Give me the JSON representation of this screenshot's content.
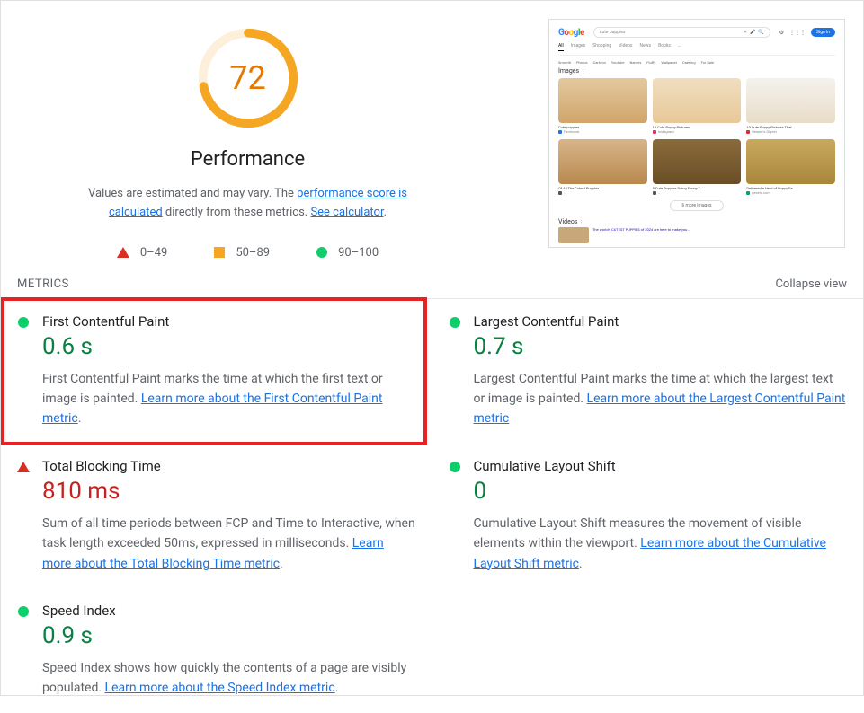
{
  "score": {
    "value": "72",
    "arc_percent": 72,
    "color": "#f5a623",
    "title": "Performance",
    "desc_prefix": "Values are estimated and may vary. The ",
    "link1": "performance score is calculated",
    "desc_mid": " directly from these metrics. ",
    "link2": "See calculator",
    "desc_suffix": "."
  },
  "legend": {
    "fail": "0–49",
    "avg": "50–89",
    "pass": "90–100"
  },
  "preview": {
    "logo": "Google",
    "query": "cute puppies",
    "signin": "Sign in",
    "tabs": [
      "All",
      "Images",
      "Shopping",
      "Videos",
      "News",
      "Books",
      "…"
    ],
    "chips": [
      "Smooth",
      "Photos",
      "Cartoon",
      "Youtube",
      "Names",
      "Fluffy",
      "Wallpaper",
      "Drawing",
      "For Sale"
    ],
    "images_heading": "Images",
    "six_images_btn": "6 more images",
    "cards": [
      {
        "cap": "Cute puppies",
        "src": "Facebook",
        "fav": "#1877F2",
        "bg": "linear-gradient(#e3c9a0,#d1a56a)"
      },
      {
        "cap": "10 Cute Puppy Pictures",
        "src": "Instagram",
        "fav": "#E1306C",
        "bg": "linear-gradient(#f0dec0,#e8c898)"
      },
      {
        "cap": "10 Cute Puppy Pictures That …",
        "src": "Reader's Digest",
        "fav": "#d93025",
        "bg": "linear-gradient(#f5f2ed,#e8dcc8)"
      },
      {
        "cap": "Of All The Cutest Puppies …",
        "src": "…",
        "fav": "#555",
        "bg": "linear-gradient(#d8b58a,#b8894f)"
      },
      {
        "cap": "8 Cute Puppies Doing Funny T…",
        "src": "…",
        "fav": "#555",
        "bg": "linear-gradient(#8a6b3a,#6a4e28)"
      },
      {
        "cap": "Delivered a Herd of Puppy Fa…",
        "src": "pexels.com",
        "fav": "#05A081",
        "bg": "linear-gradient(#c9a95e,#a8873c)"
      }
    ],
    "videos_heading": "Videos",
    "video_line": "The world's CUTEST PUPPIES of 2024 are here to make you …"
  },
  "metrics_header": {
    "title": "METRICS",
    "collapse": "Collapse view"
  },
  "metrics": {
    "fcp": {
      "name": "First Contentful Paint",
      "value": "0.6 s",
      "status": "green",
      "desc": "First Contentful Paint marks the time at which the first text or image is painted. ",
      "link": "Learn more about the First Contentful Paint metric",
      "suffix": "."
    },
    "lcp": {
      "name": "Largest Contentful Paint",
      "value": "0.7 s",
      "status": "green",
      "desc": "Largest Contentful Paint marks the time at which the largest text or image is painted. ",
      "link": "Learn more about the Largest Contentful Paint metric",
      "suffix": ""
    },
    "tbt": {
      "name": "Total Blocking Time",
      "value": "810 ms",
      "status": "red",
      "desc": "Sum of all time periods between FCP and Time to Interactive, when task length exceeded 50ms, expressed in milliseconds. ",
      "link": "Learn more about the Total Blocking Time metric",
      "suffix": "."
    },
    "cls": {
      "name": "Cumulative Layout Shift",
      "value": "0",
      "status": "green",
      "desc": "Cumulative Layout Shift measures the movement of visible elements within the viewport. ",
      "link": "Learn more about the Cumulative Layout Shift metric",
      "suffix": "."
    },
    "si": {
      "name": "Speed Index",
      "value": "0.9 s",
      "status": "green",
      "desc": "Speed Index shows how quickly the contents of a page are visibly populated. ",
      "link": "Learn more about the Speed Index metric",
      "suffix": "."
    }
  }
}
